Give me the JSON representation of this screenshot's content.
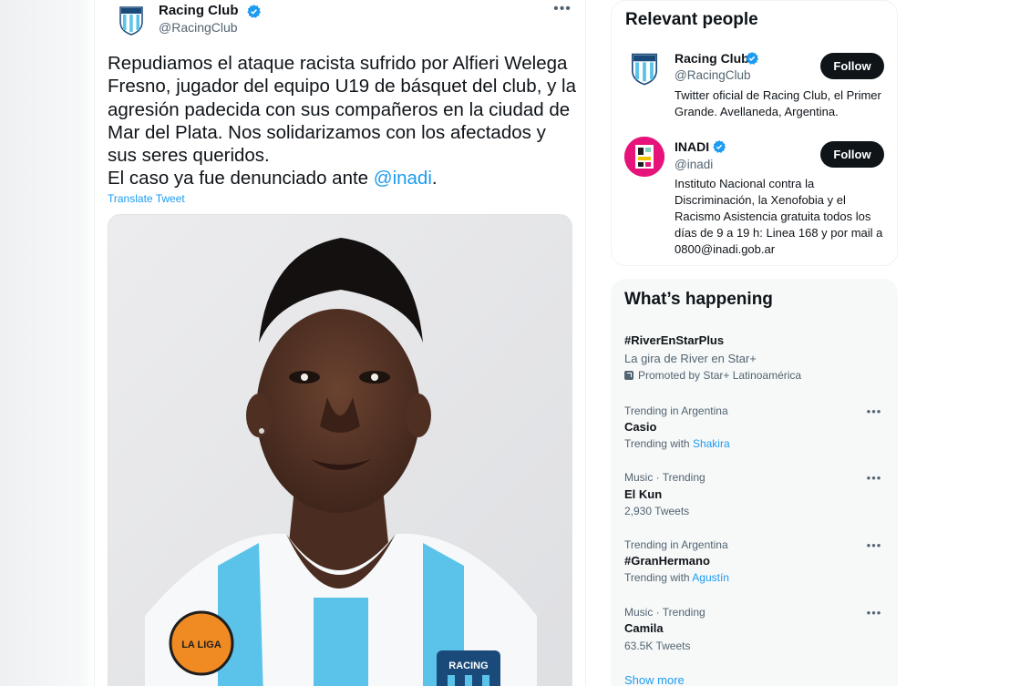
{
  "tweet": {
    "author_name": "Racing Club",
    "author_handle": "@RacingClub",
    "more_icon": "ellipsis-icon",
    "text_main": "Repudiamos el ataque racista sufrido por Alfieri Welega Fresno, jugador del equipo U19 de básquet del club, y la agresión padecida con sus compañeros en la ciudad de Mar del Plata. Nos solidarizamos con los afectados y sus seres queridos.",
    "text_line2_prefix": "El caso ya fue denunciado ante ",
    "text_mention": "@inadi",
    "text_line2_suffix": ".",
    "translate_label": "Translate Tweet",
    "photo_jersey_text": "RACING",
    "photo_badge_text": "LA LIGA"
  },
  "relevant_people": {
    "title": "Relevant people",
    "people": [
      {
        "name": "Racing Club",
        "handle": "@RacingClub",
        "bio": "Twitter oficial de Racing Club, el Primer Grande. Avellaneda, Argentina.",
        "follow_label": "Follow"
      },
      {
        "name": "INADI",
        "handle": "@inadi",
        "bio": "Instituto Nacional contra la Discriminación, la Xenofobia y el Racismo Asistencia gratuita todos los días de 9 a 19 h: Linea 168 y por mail a 0800@inadi.gob.ar",
        "follow_label": "Follow"
      }
    ]
  },
  "whats_happening": {
    "title": "What’s happening",
    "trends": [
      {
        "meta": "",
        "title": "#RiverEnStarPlus",
        "sub": "La gira de River en Star+",
        "promoted": "Promoted by Star+ Latinoamérica"
      },
      {
        "meta": "Trending in Argentina",
        "title": "Casio",
        "sub_prefix": "Trending with ",
        "sub_link": "Shakira"
      },
      {
        "meta": "Music · Trending",
        "title": "El Kun",
        "sub": "2,930 Tweets"
      },
      {
        "meta": "Trending in Argentina",
        "title": "#GranHermano",
        "sub_prefix": "Trending with ",
        "sub_link": "Agustín"
      },
      {
        "meta": "Music · Trending",
        "title": "Camila",
        "sub": "63.5K Tweets"
      }
    ],
    "show_more": "Show more"
  },
  "colors": {
    "accent": "#1d9bf0",
    "text": "#0f1419",
    "muted": "#536471",
    "racing_blue": "#5bc3ea",
    "inadi_pink": "#e6147a"
  }
}
